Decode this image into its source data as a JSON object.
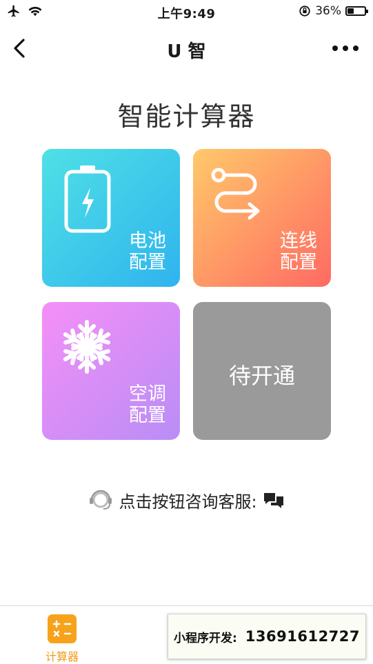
{
  "status_bar": {
    "time": "上午9:49",
    "battery_percent": "36%",
    "battery_level": 0.36,
    "icons": [
      "airplane-icon",
      "wifi-icon",
      "rotation-lock-icon",
      "battery-icon"
    ]
  },
  "nav": {
    "title": "U 智",
    "back_icon": "chevron-left-icon",
    "more_icon": "more-dots-icon"
  },
  "page": {
    "title": "智能计算器"
  },
  "tiles": [
    {
      "line1": "电池",
      "line2": "配置",
      "icon": "battery-charge-icon",
      "gradient": [
        "#4fe0e6",
        "#2fb4ee"
      ]
    },
    {
      "line1": "连线",
      "line2": "配置",
      "icon": "wiring-route-icon",
      "gradient": [
        "#ffc96a",
        "#ff6a62"
      ]
    },
    {
      "line1": "空调",
      "line2": "配置",
      "icon": "snowflake-icon",
      "gradient": [
        "#f58ff7",
        "#b88ef6"
      ]
    },
    {
      "label": "待开通",
      "color": "#9a9a9a"
    }
  ],
  "support": {
    "text": "点击按钮咨询客服:",
    "icons": [
      "headset-icon",
      "chat-bubbles-icon"
    ]
  },
  "tabbar": {
    "active_label": "计算器",
    "active_icon": "calculator-icon",
    "active_color": "#f7a21b"
  },
  "promo": {
    "label": "小程序开发:",
    "phone": "13691612727"
  }
}
